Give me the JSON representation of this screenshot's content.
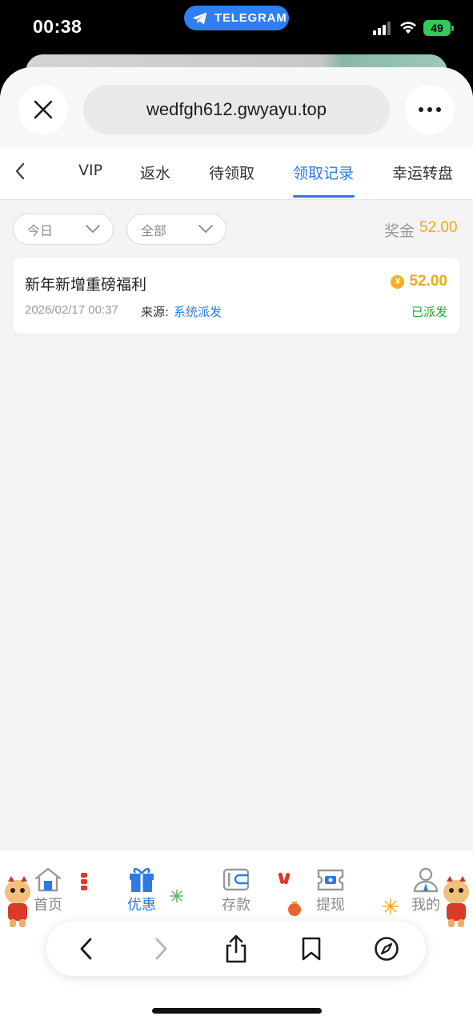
{
  "status_bar": {
    "time": "00:38",
    "telegram_label": "TELEGRAM",
    "battery": "49"
  },
  "browser": {
    "url": "wedfgh612.gwyayu.top"
  },
  "tabs": [
    {
      "label": "VIP"
    },
    {
      "label": "返水"
    },
    {
      "label": "待领取"
    },
    {
      "label": "领取记录",
      "active": true
    },
    {
      "label": "幸运转盘"
    }
  ],
  "filters": {
    "date": "今日",
    "type": "全部",
    "bonus_label": "奖金",
    "bonus_total": "52.00"
  },
  "records": [
    {
      "title": "新年新增重磅福利",
      "amount": "52.00",
      "date": "2026/02/17 00:37",
      "source_label": "来源:",
      "source": "系统派发",
      "status": "已派发"
    }
  ],
  "bottom_nav": [
    {
      "label": "首页",
      "icon": "home-icon"
    },
    {
      "label": "优惠",
      "icon": "gift-icon",
      "active": true
    },
    {
      "label": "存款",
      "icon": "wallet-icon"
    },
    {
      "label": "提现",
      "icon": "withdraw-icon"
    },
    {
      "label": "我的",
      "icon": "user-icon"
    }
  ],
  "colors": {
    "accent": "#2c7be5",
    "gold": "#f0a81c",
    "success": "#1aad3a",
    "telegram": "#2f7ff0"
  }
}
